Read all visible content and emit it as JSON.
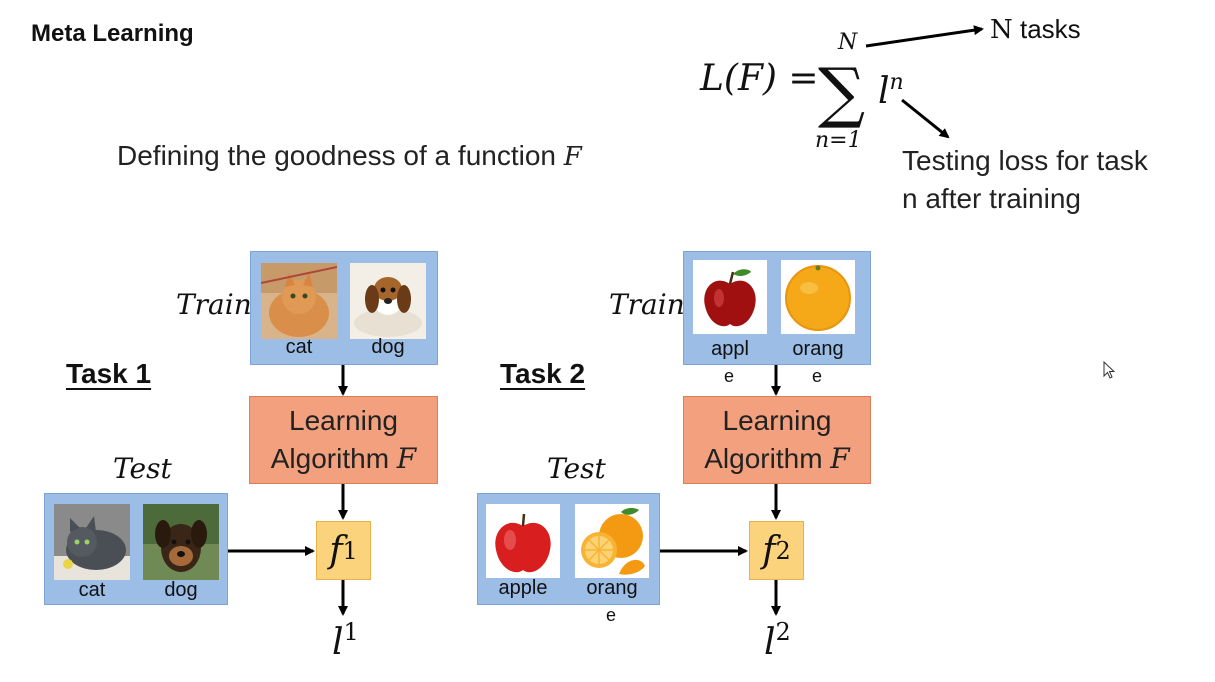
{
  "title": "Meta Learning",
  "subtitle": {
    "text": "Defining the goodness of a function ",
    "var": "F"
  },
  "formula": {
    "lhs": "L(F) = ",
    "sigma": "∑",
    "upper": "N",
    "lower": "n=1",
    "term": "l",
    "term_sup": "n",
    "annotation_tasks": {
      "var": "N",
      "text": " tasks"
    },
    "annotation_loss": [
      "Testing loss for task",
      "n after training"
    ]
  },
  "task1": {
    "label": "Task 1",
    "train_label": "Train",
    "test_label": "Test",
    "train_images": [
      {
        "caption": "cat",
        "icon": "cat-photo"
      },
      {
        "caption": "dog",
        "icon": "dog-photo"
      }
    ],
    "test_images": [
      {
        "caption": "cat",
        "icon": "cat-photo"
      },
      {
        "caption": "dog",
        "icon": "dog-photo"
      }
    ],
    "algo_line1": "Learning",
    "algo_line2": "Algorithm ",
    "algo_var": "F",
    "f": "f",
    "f_sup": "1",
    "l": "l",
    "l_sup": "1"
  },
  "task2": {
    "label": "Task 2",
    "train_label": "Train",
    "test_label": "Test",
    "train_images": [
      {
        "caption": "appl",
        "caption2": "e",
        "icon": "apple-photo"
      },
      {
        "caption": "orang",
        "caption2": "e",
        "icon": "orange-photo"
      }
    ],
    "test_images": [
      {
        "caption": "apple",
        "icon": "apple-photo"
      },
      {
        "caption": "orang",
        "caption2": "e",
        "icon": "orange-slices-photo"
      }
    ],
    "algo_line1": "Learning",
    "algo_line2": "Algorithm ",
    "algo_var": "F",
    "f": "f",
    "f_sup": "2",
    "l": "l",
    "l_sup": "2"
  },
  "colors": {
    "blue": "#9bbde6",
    "orange": "#f2a07e",
    "yellow": "#fbd37c"
  }
}
